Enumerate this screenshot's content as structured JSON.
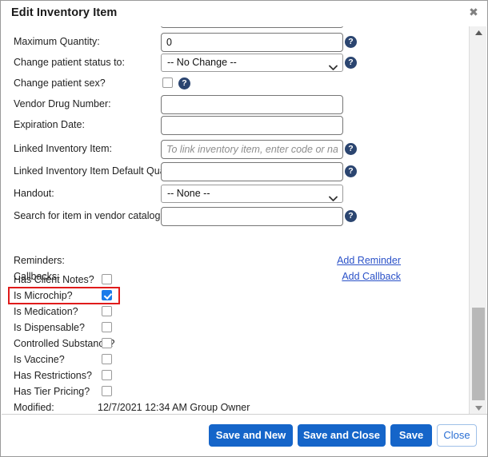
{
  "window": {
    "title": "Edit Inventory Item",
    "close_icon": "close-icon"
  },
  "form": {
    "rows": [
      {
        "label": "Maximum Quantity:",
        "type": "text",
        "value": "0",
        "placeholder": "",
        "help": true
      },
      {
        "label": "Change patient status to:",
        "type": "select",
        "value": "-- No Change --",
        "help": true
      },
      {
        "label": "Change patient sex?",
        "type": "checkbox",
        "checked": false,
        "help": true
      },
      {
        "label": "Vendor Drug Number:",
        "type": "text",
        "value": "",
        "placeholder": "",
        "help": false
      },
      {
        "label": "Expiration Date:",
        "type": "text",
        "value": "",
        "placeholder": "",
        "help": false
      },
      {
        "label": "Linked Inventory Item:",
        "type": "text",
        "value": "",
        "placeholder": "To link inventory item, enter code or name",
        "help": true
      },
      {
        "label": "Linked Inventory Item Default Quantity",
        "type": "text",
        "value": "",
        "placeholder": "",
        "help": true
      },
      {
        "label": "Handout:",
        "type": "select",
        "value": "-- None --",
        "help": false
      },
      {
        "label": "Search for item in vendor catalog:",
        "type": "text",
        "value": "",
        "placeholder": "",
        "help": true
      }
    ]
  },
  "reminders": {
    "reminders_label": "Reminders:",
    "callbacks_label": "Callbacks:",
    "add_reminder_link": "Add Reminder",
    "add_callback_link": "Add Callback"
  },
  "flags": [
    {
      "label": "Has Client Notes?",
      "checked": false
    },
    {
      "label": "Is Microchip?",
      "checked": true
    },
    {
      "label": "Is Medication?",
      "checked": false
    },
    {
      "label": "Is Dispensable?",
      "checked": false
    },
    {
      "label": "Controlled Substance?",
      "checked": false
    },
    {
      "label": "Is Vaccine?",
      "checked": false
    },
    {
      "label": "Has Restrictions?",
      "checked": false
    },
    {
      "label": "Has Tier Pricing?",
      "checked": false
    }
  ],
  "modified": {
    "label": "Modified:",
    "value": "12/7/2021 12:34 AM Group Owner"
  },
  "footer": {
    "save_and_new": "Save and New",
    "save_and_close": "Save and Close",
    "save": "Save",
    "close": "Close"
  },
  "colors": {
    "primary_button": "#1565c9",
    "link": "#2a51c8",
    "checkbox_checked": "#1a7bea",
    "highlight_box": "#e01b1b",
    "help_icon": "#2b4570"
  },
  "scrollbar": {
    "up_icon": "triangle-up-icon",
    "down_icon": "triangle-down-icon"
  }
}
